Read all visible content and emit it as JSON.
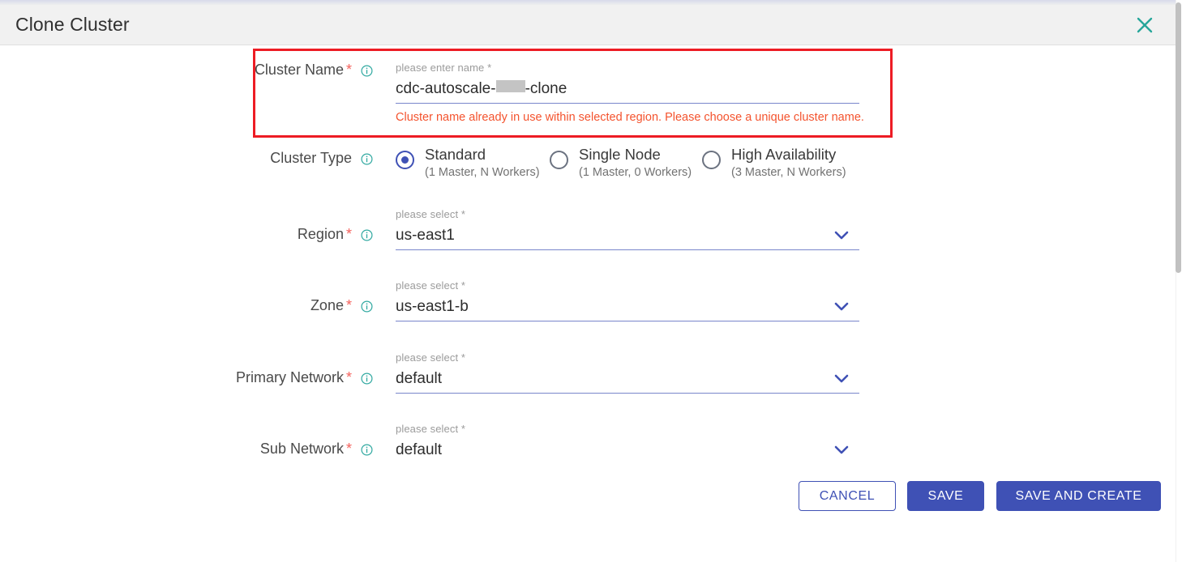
{
  "dialog": {
    "title": "Clone Cluster",
    "close_icon": "close-icon"
  },
  "form": {
    "cluster_name": {
      "label": "Cluster Name",
      "required_mark": "*",
      "hint": "please enter name *",
      "value_prefix": "cdc-autoscale-",
      "value_suffix": "-clone",
      "error": "Cluster name already in use within selected region. Please choose a unique cluster name."
    },
    "cluster_type": {
      "label": "Cluster Type",
      "options": [
        {
          "title": "Standard",
          "subtitle": "(1 Master, N Workers)",
          "selected": true
        },
        {
          "title": "Single Node",
          "subtitle": "(1 Master, 0 Workers)",
          "selected": false
        },
        {
          "title": "High Availability",
          "subtitle": "(3 Master, N Workers)",
          "selected": false
        }
      ]
    },
    "region": {
      "label": "Region",
      "required_mark": "*",
      "hint": "please select *",
      "value": "us-east1"
    },
    "zone": {
      "label": "Zone",
      "required_mark": "*",
      "hint": "please select *",
      "value": "us-east1-b"
    },
    "primary_network": {
      "label": "Primary Network",
      "required_mark": "*",
      "hint": "please select *",
      "value": "default"
    },
    "sub_network": {
      "label": "Sub Network",
      "required_mark": "*",
      "hint": "please select *",
      "value": "default"
    }
  },
  "buttons": {
    "cancel": "CANCEL",
    "save": "SAVE",
    "save_and_create": "SAVE AND CREATE"
  },
  "colors": {
    "accent_blue": "#3f51b5",
    "info_teal": "#2fa8a0",
    "error_red": "#f4532e",
    "highlight_red": "#ed1c24",
    "required_star": "#f4615c"
  }
}
